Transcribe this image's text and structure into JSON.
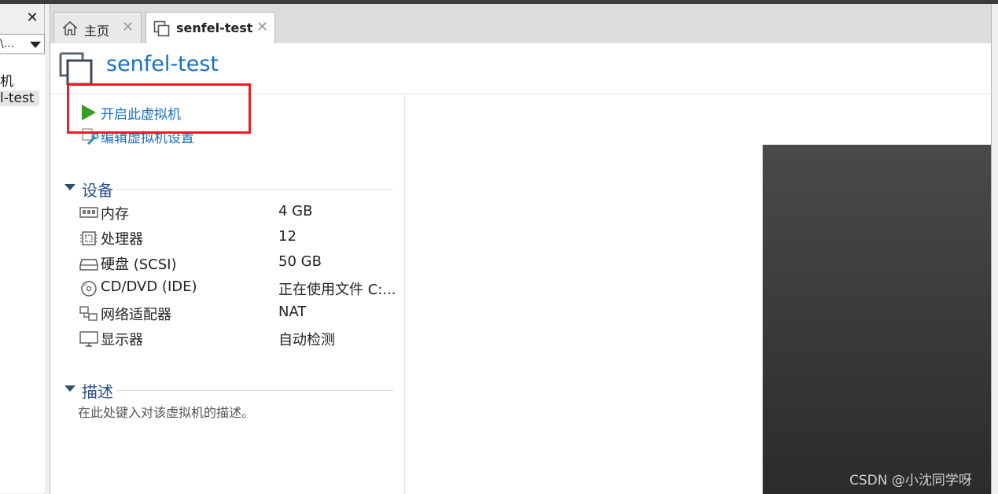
{
  "library": {
    "close_glyph": "✕",
    "search_text": "\\...",
    "items": [
      {
        "label": "机"
      },
      {
        "label": "l-test"
      }
    ]
  },
  "tabs": [
    {
      "label": "主页",
      "icon": "home-icon",
      "close": "✕"
    },
    {
      "label": "senfel-test",
      "icon": "vm-icon",
      "close": "✕"
    }
  ],
  "vm": {
    "title": "senfel-test",
    "actions": {
      "power_on": "开启此虚拟机",
      "edit_settings": "编辑虚拟机设置"
    }
  },
  "devices": {
    "section_title": "设备",
    "items": [
      {
        "name": "内存",
        "value": "4 GB",
        "icon": "memory-icon"
      },
      {
        "name": "处理器",
        "value": "12",
        "icon": "processor-icon"
      },
      {
        "name": "硬盘 (SCSI)",
        "value": "50 GB",
        "icon": "harddisk-icon"
      },
      {
        "name": "CD/DVD (IDE)",
        "value": "正在使用文件 C:...",
        "icon": "cd-dvd-icon"
      },
      {
        "name": "网络适配器",
        "value": "NAT",
        "icon": "network-adapter-icon"
      },
      {
        "name": "显示器",
        "value": "自动检测",
        "icon": "display-icon"
      }
    ]
  },
  "description": {
    "section_title": "描述",
    "placeholder": "在此处键入对该虚拟机的描述。"
  },
  "watermark": "CSDN @小沈同学呀",
  "colors": {
    "accent": "#1a6fc4",
    "play": "#3a9d23",
    "highlight": "#ed1c24"
  }
}
